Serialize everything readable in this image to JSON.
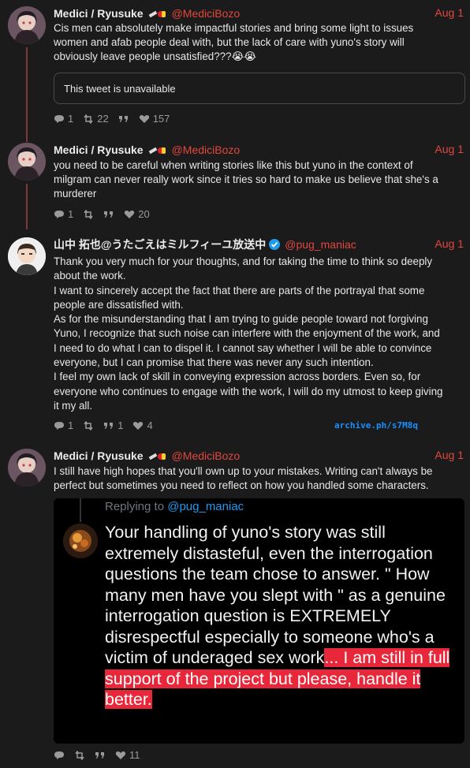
{
  "colors": {
    "background": "#1b1b1b",
    "accent": "#e2473f",
    "thread_line": "#7a3a3a",
    "highlight": "#e8283a",
    "link": "#1a8fff"
  },
  "tweets": [
    {
      "name": "Medici / Ryusuke",
      "handle": "@MediciBozo",
      "date": "Aug 1",
      "lines": [
        "Cis men can absolutely make impactful stories and bring some light to issues",
        "women and afab people deal with, but the lack of care with yuno's story will",
        "obviously leave people unsatisfied???😭😭"
      ],
      "quote_unavailable": "This tweet is unavailable",
      "replies": "1",
      "retweets": "22",
      "likes": "157"
    },
    {
      "name": "Medici / Ryusuke",
      "handle": "@MediciBozo",
      "date": "Aug 1",
      "lines": [
        "you need to be careful when writing stories like this but yuno in the context of",
        "milgram can never really work since it tries so hard to make us believe that she's a",
        "murderer"
      ],
      "replies": "1",
      "retweets": "",
      "likes": "20"
    },
    {
      "name": "山中 拓也@うたごえはミルフィーユ放送中",
      "handle": "@pug_maniac",
      "date": "Aug 1",
      "lines": [
        "Thank you very much for your thoughts, and for taking the time to think so deeply",
        "about the work.",
        "I want to sincerely accept the fact that there are parts of the portrayal that some",
        "people are dissatisfied with.",
        "As for the misunderstanding that I am trying to guide people toward not forgiving",
        "Yuno, I recognize that such noise can interfere with the enjoyment of the work, and",
        "I need to do what I can to dispel it. I cannot say whether I will be able to convince",
        "everyone, but I can promise that there was never any such intention.",
        "I feel my own lack of skill in conveying expression across borders. Even so, for",
        "everyone who continues to engage with the work, I will do my utmost to keep giving",
        "it my all."
      ],
      "replies": "1",
      "retweets": "",
      "quotes": "1",
      "likes": "4",
      "archive": "archive.ph/s7M8q"
    },
    {
      "name": "Medici / Ryusuke",
      "handle": "@MediciBozo",
      "date": "Aug 1",
      "lines": [
        "I still have high hopes that you'll own up to your mistakes. Writing can't always be",
        "perfect but sometimes you need to reflect on how you handled some characters."
      ],
      "embed": {
        "replying_prefix": "Replying to ",
        "replying_handle": "@pug_maniac",
        "text_plain": "Your handling of yuno's story was still extremely distasteful, even the interrogation questions the team chose to answer. \" How many men have you slept with \" as a genuine interrogation question is EXTREMELY disrespectful especially to someone who's a victim of underaged sex work",
        "text_highlight": "... I am still in full support of the project but please, handle it better."
      },
      "replies": "",
      "retweets": "",
      "likes": "11"
    }
  ]
}
